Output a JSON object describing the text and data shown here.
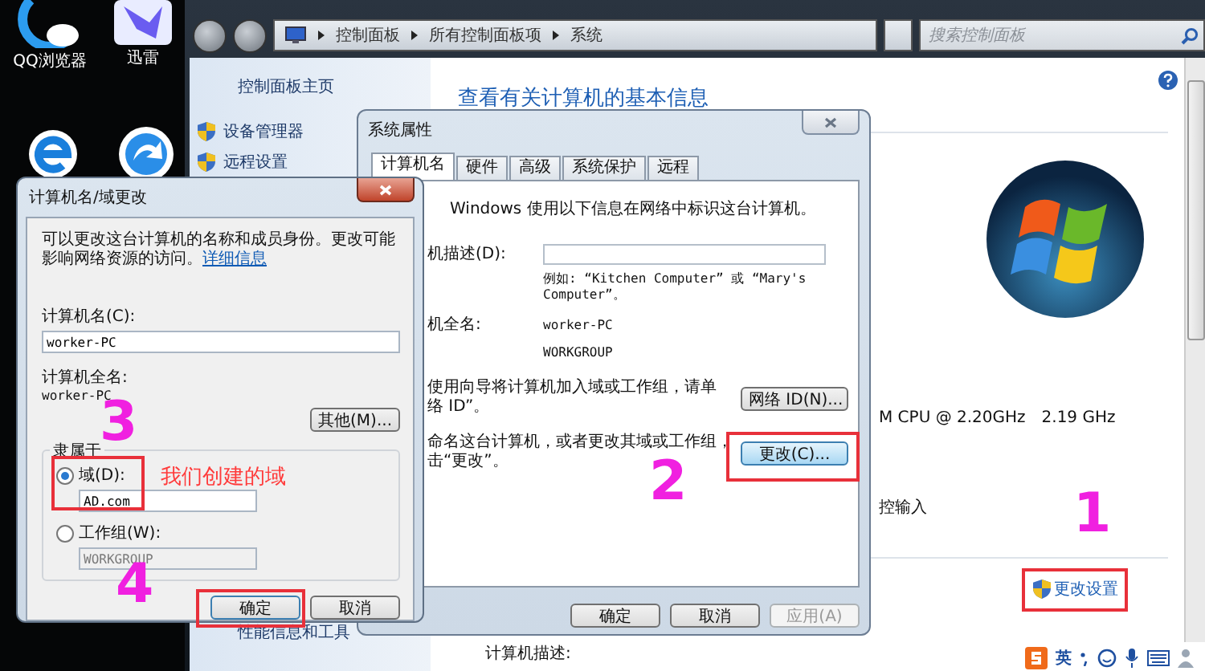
{
  "desktop_icons": [
    {
      "kind": "qq-browser",
      "label": "QQ浏览器"
    },
    {
      "kind": "thunder",
      "label": "迅雷"
    },
    {
      "kind": "ie"
    },
    {
      "kind": "arrow"
    }
  ],
  "control_panel": {
    "breadcrumb": [
      "控制面板",
      "所有控制面板项",
      "系统"
    ],
    "search": {
      "placeholder": "搜索控制面板"
    },
    "sidebar": {
      "home": "控制面板主页",
      "items": [
        "设备管理器",
        "远程设置"
      ],
      "see_also": "性能信息和工具"
    },
    "heading": "查看有关计算机的基本信息",
    "processor": "M CPU @ 2.20GHz",
    "speed": "2.19 GHz",
    "pen_touch": "控输入",
    "change_settings": "更改设置",
    "description_label": "计算机描述:"
  },
  "system_properties": {
    "title": "系统属性",
    "tabs": [
      {
        "label": "计算机名",
        "selected": true
      },
      {
        "label": "硬件",
        "selected": false
      },
      {
        "label": "高级",
        "selected": false
      },
      {
        "label": "系统保护",
        "selected": false
      },
      {
        "label": "远程",
        "selected": false
      }
    ],
    "intro": "Windows 使用以下信息在网络中标识这台计算机。",
    "description_label": "机描述(D):",
    "example": [
      "例如: “Kitchen Computer” 或 “Mary's",
      "Computer”。"
    ],
    "full_name_label": "机全名:",
    "full_name": "worker-PC",
    "workgroup": "WORKGROUP",
    "network_id_text": [
      "使用向导将计算机加入域或工作组，请单",
      "络 ID”。"
    ],
    "network_id_button": "网络 ID(N)...",
    "rename_text": [
      "命名这台计算机，或者更改其域或工作组，",
      "击“更改”。"
    ],
    "change_button": "更改(C)...",
    "buttons": [
      {
        "label": "确定",
        "disabled": false
      },
      {
        "label": "取消",
        "disabled": false
      },
      {
        "label": "应用(A)",
        "disabled": true
      }
    ]
  },
  "name_change_dialog": {
    "title": "计算机名/域更改",
    "intro": "可以更改这台计算机的名称和成员身份。更改可能影响网络资源的访问。",
    "link": "详细信息",
    "name_label": "计算机名(C):",
    "name_value": "worker-PC",
    "full_name_label": "计算机全名:",
    "full_name": "worker-PC",
    "more_button": "其他(M)...",
    "member_of": "隶属于",
    "options": [
      {
        "label": "域(D):",
        "selected": true,
        "value": "AD.com",
        "disabled": false
      },
      {
        "label": "工作组(W):",
        "selected": false,
        "value": "WORKGROUP",
        "disabled": true
      }
    ],
    "buttons": [
      "确定",
      "取消"
    ]
  },
  "annotations": {
    "numbers": [
      "1",
      "2",
      "3",
      "4"
    ],
    "note": "我们创建的域"
  },
  "ime_bar": {
    "language": "英"
  }
}
